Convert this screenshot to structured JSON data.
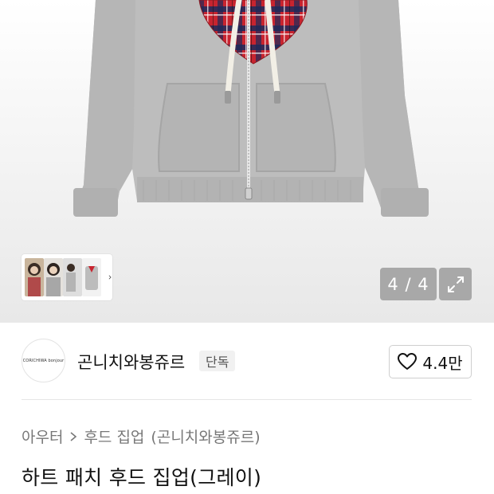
{
  "gallery": {
    "counter": "4 / 4",
    "icons": {
      "thumbs_next": "chevron-right-icon",
      "expand": "expand-arrows-icon"
    }
  },
  "brand": {
    "logo_text": "CORICHIWA bonjour",
    "name": "곤니치와봉쥬르",
    "badge": "단독",
    "likes": "4.4만",
    "like_icon": "heart-outline-icon"
  },
  "breadcrumb": {
    "category": "아우터",
    "subcategory": "후드 집업",
    "brand": "(곤니치와봉쥬르)"
  },
  "product": {
    "title": "하트 패치 후드 집업(그레이)"
  },
  "colors": {
    "hoodie_gray": "#b9b9b9",
    "plaid_red": "#c8242f",
    "plaid_navy": "#1d2a5a",
    "counter_bg": "#a8a8a8"
  }
}
